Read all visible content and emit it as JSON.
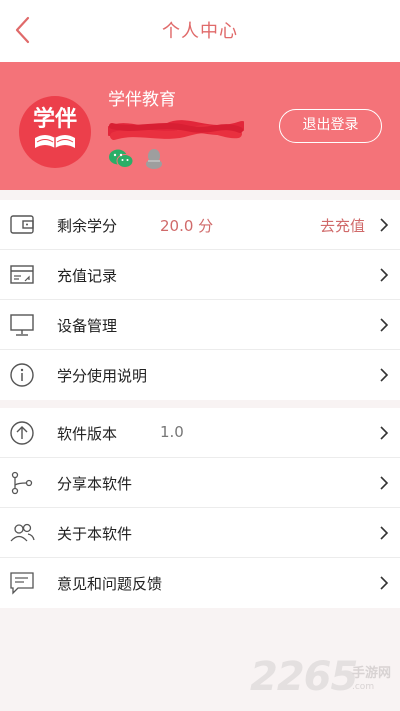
{
  "header": {
    "title": "个人中心",
    "back_icon": "chevron-left-icon",
    "accent_color": "#e06a6a"
  },
  "profile": {
    "background_color": "#f47379",
    "avatar_text": "学伴",
    "org_name": "学伴教育",
    "logout_label": "退出登录",
    "social_icons": [
      "wechat-icon",
      "qq-icon"
    ]
  },
  "account": [
    {
      "icon": "wallet-icon",
      "label": "剩余学分",
      "value": "20.0 分",
      "action": "去充值"
    },
    {
      "icon": "receipt-icon",
      "label": "充值记录"
    },
    {
      "icon": "monitor-icon",
      "label": "设备管理"
    },
    {
      "icon": "info-icon",
      "label": "学分使用说明"
    }
  ],
  "about": [
    {
      "icon": "upload-arrow-icon",
      "label": "软件版本",
      "value": "1.0"
    },
    {
      "icon": "share-icon",
      "label": "分享本软件"
    },
    {
      "icon": "users-icon",
      "label": "关于本软件"
    },
    {
      "icon": "message-icon",
      "label": "意见和问题反馈"
    }
  ],
  "watermark": {
    "number": "2265",
    "text": "手游网",
    "url": ".com"
  }
}
